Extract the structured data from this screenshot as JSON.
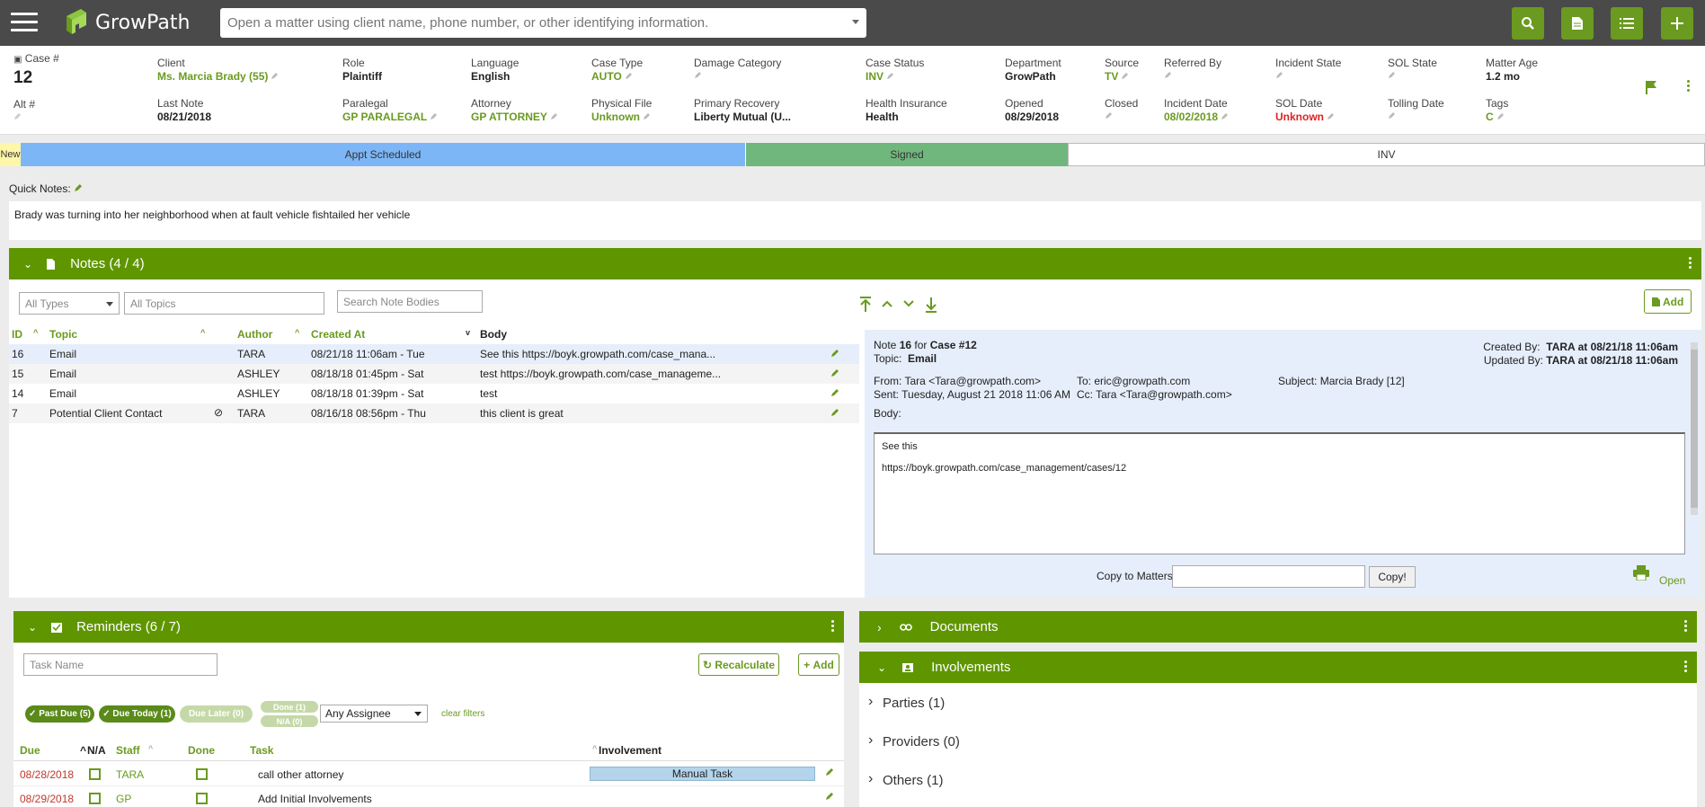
{
  "topbar": {
    "logo_text": "GrowPath",
    "search_placeholder": "Open a matter using client name, phone number, or other identifying information."
  },
  "case": {
    "case_label": "Case #",
    "case_number": "12",
    "alt_label": "Alt #",
    "fields_row1": [
      {
        "label": "Client",
        "value": "Ms. Marcia Brady (55)",
        "color": "green"
      },
      {
        "label": "Role",
        "value": "Plaintiff",
        "color": "dark"
      },
      {
        "label": "Language",
        "value": "English",
        "color": "dark"
      },
      {
        "label": "Case Type",
        "value": "AUTO",
        "color": "green"
      },
      {
        "label": "Damage Category",
        "value": "",
        "color": "green"
      },
      {
        "label": "Case Status",
        "value": "INV",
        "color": "green"
      },
      {
        "label": "Department",
        "value": "GrowPath",
        "color": "dark"
      },
      {
        "label": "Source",
        "value": "TV",
        "color": "green"
      },
      {
        "label": "Referred By",
        "value": "",
        "color": "green"
      },
      {
        "label": "Incident State",
        "value": "",
        "color": "green"
      },
      {
        "label": "SOL State",
        "value": "",
        "color": "green"
      },
      {
        "label": "Matter Age",
        "value": "1.2 mo",
        "color": "dark"
      }
    ],
    "fields_row2": [
      {
        "label": "Last Note",
        "value": "08/21/2018",
        "color": "dark"
      },
      {
        "label": "Paralegal",
        "value": "GP PARALEGAL",
        "color": "green"
      },
      {
        "label": "Attorney",
        "value": "GP ATTORNEY",
        "color": "green"
      },
      {
        "label": "Physical File",
        "value": "Unknown",
        "color": "green"
      },
      {
        "label": "Primary Recovery",
        "value": "Liberty Mutual (U...",
        "color": "dark"
      },
      {
        "label": "Health Insurance",
        "value": "Health",
        "color": "dark"
      },
      {
        "label": "Opened",
        "value": "08/29/2018",
        "color": "dark"
      },
      {
        "label": "Closed",
        "value": "",
        "color": "green"
      },
      {
        "label": "Incident Date",
        "value": "08/02/2018",
        "color": "green"
      },
      {
        "label": "SOL Date",
        "value": "Unknown",
        "color": "red"
      },
      {
        "label": "Tolling Date",
        "value": "",
        "color": "green"
      },
      {
        "label": "Tags",
        "value": "C",
        "color": "green"
      }
    ]
  },
  "stages": [
    {
      "label": "New",
      "color": "#fff7a8"
    },
    {
      "label": "Appt Scheduled",
      "color": "#7db6f6"
    },
    {
      "label": "Signed",
      "color": "#70b77e"
    },
    {
      "label": "INV",
      "color": "#ffffff"
    }
  ],
  "quick_notes": {
    "label": "Quick Notes:",
    "text": "Brady was turning into her neighborhood when at fault vehicle fishtailed her vehicle"
  },
  "notes": {
    "title": "Notes (4 / 4)",
    "filter_types": "All Types",
    "filter_topics": "All Topics",
    "search_placeholder": "Search Note Bodies",
    "add_label": "Add",
    "columns": {
      "id": "ID",
      "topic": "Topic",
      "author": "Author",
      "created": "Created At",
      "body": "Body"
    },
    "rows": [
      {
        "id": "16",
        "topic": "Email",
        "author": "TARA",
        "created": "08/21/18 11:06am - Tue",
        "body": "See this https://boyk.growpath.com/case_mana..."
      },
      {
        "id": "15",
        "topic": "Email",
        "author": "ASHLEY",
        "created": "08/18/18 01:45pm - Sat",
        "body": "test https://boyk.growpath.com/case_manageme..."
      },
      {
        "id": "14",
        "topic": "Email",
        "author": "ASHLEY",
        "created": "08/18/18 01:39pm - Sat",
        "body": "test"
      },
      {
        "id": "7",
        "topic": "Potential Client Contact",
        "author": "TARA",
        "created": "08/16/18 08:56pm - Thu",
        "body": "this client is great"
      }
    ],
    "detail": {
      "note_prefix": "Note",
      "note_id": "16",
      "for_text": "for",
      "case_ref": "Case #12",
      "topic_label": "Topic:",
      "topic_value": "Email",
      "created_label": "Created By:",
      "created_value": "TARA at 08/21/18 11:06am",
      "updated_label": "Updated By:",
      "updated_value": "TARA at 08/21/18 11:06am",
      "from": "From: Tara <Tara@growpath.com>",
      "sent": "Sent: Tuesday, August 21 2018 11:06 AM",
      "to": "To: eric@growpath.com",
      "cc": "Cc: Tara <Tara@growpath.com>",
      "subject": "Subject: Marcia Brady [12]",
      "body_label": "Body:",
      "body_line1": "See this",
      "body_line2": "https://boyk.growpath.com/case_management/cases/12",
      "copy_label": "Copy to Matters",
      "copy_button": "Copy!",
      "open_label": "Open"
    }
  },
  "reminders": {
    "title": "Reminders (6 / 7)",
    "task_placeholder": "Task Name",
    "recalculate": "Recalculate",
    "add_label": "Add",
    "chips": {
      "past_due": "Past Due (5)",
      "due_today": "Due Today (1)",
      "due_later": "Due Later (0)",
      "done": "Done (1)",
      "na": "N/A (0)"
    },
    "assignee": "Any Assignee",
    "clear_filters": "clear filters",
    "columns": {
      "due": "Due",
      "na": "N/A",
      "staff": "Staff",
      "done": "Done",
      "task": "Task",
      "involvement": "Involvement"
    },
    "rows": [
      {
        "due": "08/28/2018",
        "staff": "TARA",
        "task": "call other attorney",
        "involvement": "Manual Task"
      },
      {
        "due": "08/29/2018",
        "staff": "GP",
        "task": "Add Initial Involvements",
        "involvement": ""
      }
    ]
  },
  "documents": {
    "title": "Documents"
  },
  "involvements": {
    "title": "Involvements",
    "items": [
      "Parties (1)",
      "Providers (0)",
      "Others (1)"
    ]
  }
}
